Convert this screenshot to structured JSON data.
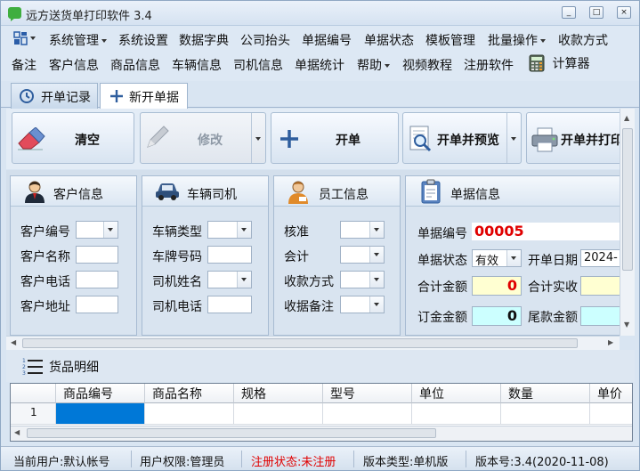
{
  "window": {
    "title": "远方送货单打印软件 3.4",
    "min_label": "_",
    "max_label": "□",
    "close_label": "×"
  },
  "menu1": [
    "系统管理",
    "系统设置",
    "数据字典",
    "公司抬头",
    "单据编号",
    "单据状态",
    "模板管理",
    "批量操作",
    "收款方式"
  ],
  "menu2": [
    "备注",
    "客户信息",
    "商品信息",
    "车辆信息",
    "司机信息",
    "单据统计",
    "帮助",
    "视频教程",
    "注册软件",
    "计算器"
  ],
  "tabs": {
    "records": "开单记录",
    "new": "新开单据"
  },
  "toolbar": {
    "clear": "清空",
    "edit": "修改",
    "create": "开单",
    "create_preview": "开单并预览",
    "create_print": "开单并打印"
  },
  "customer": {
    "title": "客户信息",
    "labels": [
      "客户编号",
      "客户名称",
      "客户电话",
      "客户地址"
    ]
  },
  "vehicle": {
    "title": "车辆司机",
    "labels": [
      "车辆类型",
      "车牌号码",
      "司机姓名",
      "司机电话"
    ]
  },
  "staff": {
    "title": "员工信息",
    "labels": [
      "核准",
      "会计",
      "收款方式",
      "收据备注"
    ]
  },
  "bill": {
    "title": "单据信息",
    "number_label": "单据编号",
    "number": "00005",
    "status_label": "单据状态",
    "status": "有效",
    "date_label": "开单日期",
    "date": "2024-",
    "total_label": "合计金额",
    "total": "0",
    "paid_label": "合计实收",
    "deposit_label": "订金金额",
    "deposit": "0",
    "balance_label": "尾款金额"
  },
  "goods": {
    "title": "货品明细",
    "columns": [
      "商品编号",
      "商品名称",
      "规格",
      "型号",
      "单位",
      "数量",
      "单价"
    ],
    "row_number": "1"
  },
  "status": {
    "user": "当前用户:默认帐号",
    "permission": "用户权限:管理员",
    "registration": "注册状态:未注册",
    "edition": "版本类型:单机版",
    "version": "版本号:3.4(2020-11-08)"
  },
  "colors": {
    "accent_red": "#e00000",
    "money_yellow": "#ffffd2",
    "money_cyan": "#ccffff",
    "selection_blue": "#0078d7"
  }
}
